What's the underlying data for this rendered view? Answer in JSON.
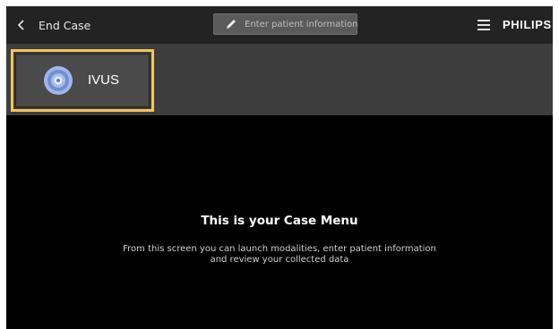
{
  "topbar": {
    "back_label": "End Case",
    "patient_button_label": "Enter patient information",
    "brand": "PHILIPS"
  },
  "modalities": [
    {
      "label": "IVUS",
      "icon": "ivus-icon",
      "selected": true
    }
  ],
  "main": {
    "title": "This is your Case Menu",
    "description_line1": "From this screen you can launch modalities, enter patient information",
    "description_line2": "and review your collected data"
  },
  "colors": {
    "topbar_bg": "#232323",
    "modality_bar_bg": "#3d3d3d",
    "selected_outline": "#f3c55a",
    "content_bg": "#000000",
    "ivus_icon": "#8fa8df"
  }
}
